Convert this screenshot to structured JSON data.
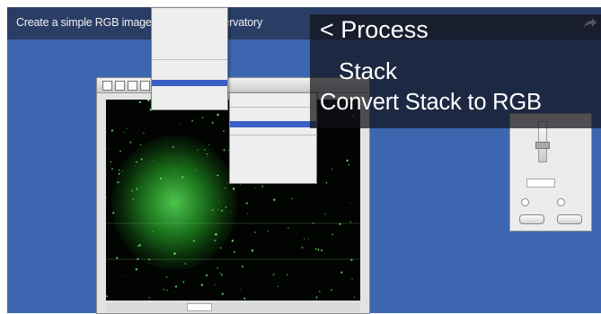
{
  "video": {
    "title": "Create a simple RGB image with MicroObservatory"
  },
  "overlay": {
    "line1": "< Process",
    "line2": "Stack",
    "line3": "Convert Stack to RGB"
  },
  "icons": {
    "share": "share-arrow-icon"
  },
  "colors": {
    "desktop": "#3c66b0",
    "overlay": "#15151c",
    "nebula": "#4fd64f",
    "menu_highlight": "#3a5fc4"
  }
}
